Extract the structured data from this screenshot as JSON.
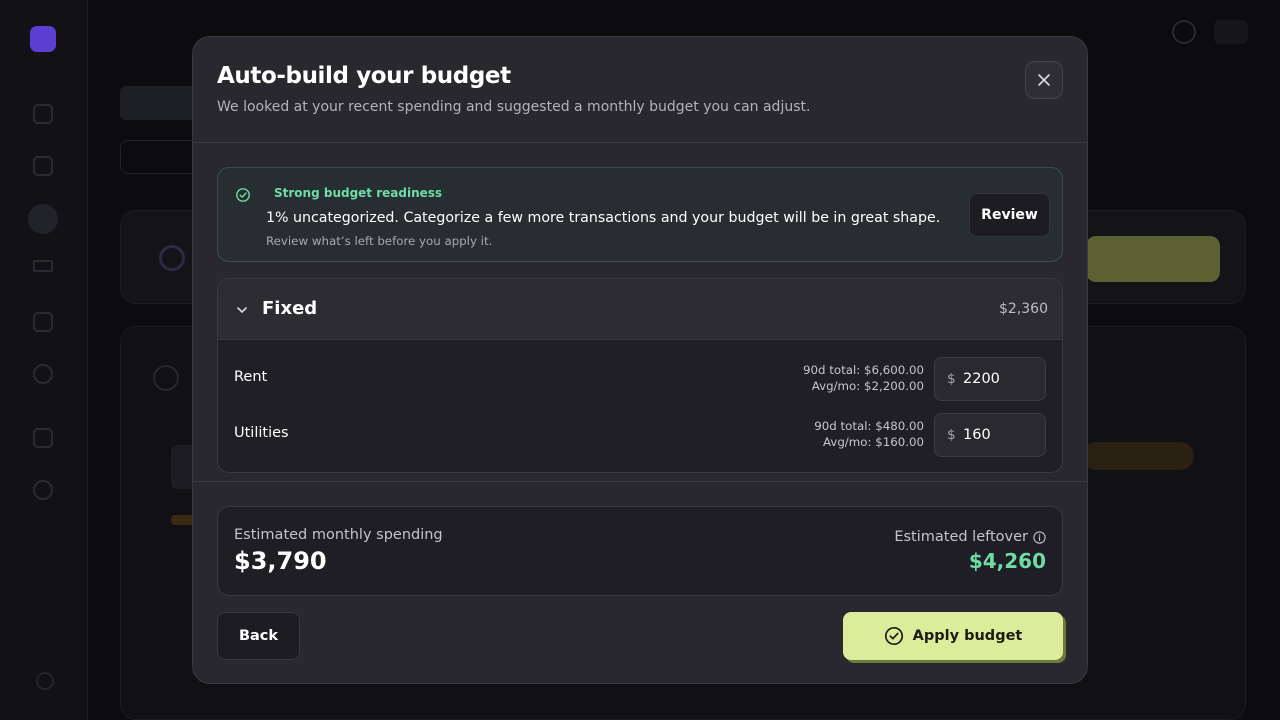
{
  "modal": {
    "title": "Auto-build your budget",
    "subtitle": "We looked at your recent spending and suggested a monthly budget you can adjust."
  },
  "readiness": {
    "label": "Strong budget readiness",
    "message": "1% uncategorized. Categorize a few more transactions and your budget will be in great shape.",
    "hint": "Review what’s left before you apply it.",
    "review_label": "Review",
    "accent_color": "#6fdba7"
  },
  "fixed": {
    "title": "Fixed",
    "total": "$2,360",
    "rows": [
      {
        "name": "Rent",
        "total_90d": "90d total: $6,600.00",
        "avg_mo": "Avg/mo: $2,200.00",
        "currency": "$",
        "amount": "2200"
      },
      {
        "name": "Utilities",
        "total_90d": "90d total: $480.00",
        "avg_mo": "Avg/mo: $160.00",
        "currency": "$",
        "amount": "160"
      }
    ]
  },
  "summary": {
    "spending_label": "Estimated monthly spending",
    "spending_value": "$3,790",
    "leftover_label": "Estimated leftover",
    "leftover_value": "$4,260"
  },
  "actions": {
    "back_label": "Back",
    "apply_label": "Apply budget",
    "apply_color": "#dcec9a"
  }
}
